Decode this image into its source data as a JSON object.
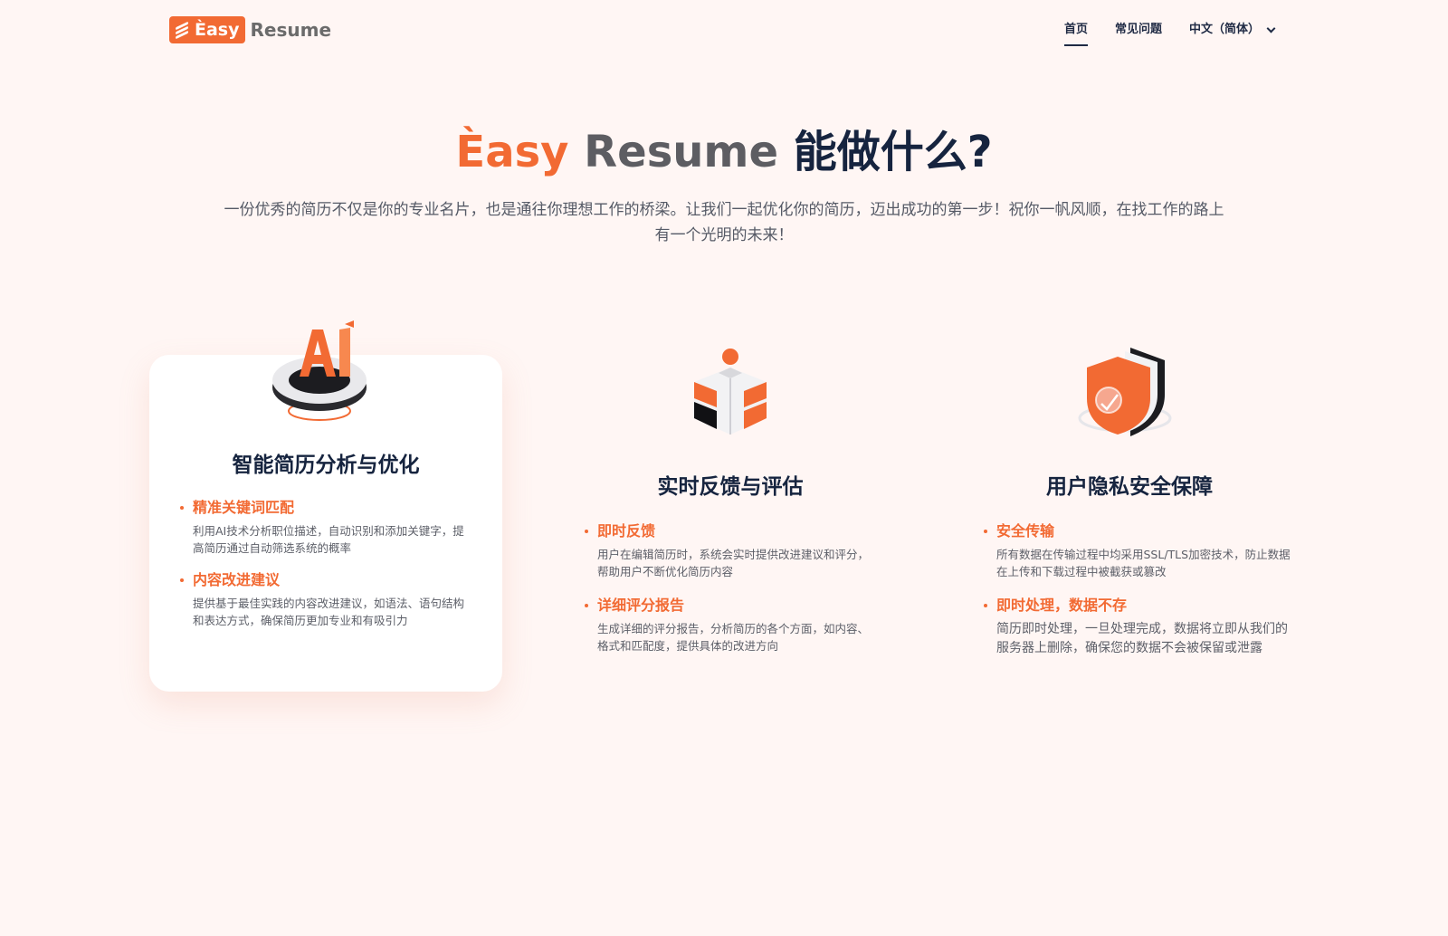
{
  "header": {
    "logo_badge": "Èasy",
    "logo_rest": "Resume",
    "nav": {
      "home": "首页",
      "faq": "常见问题",
      "language": "中文（简体）"
    }
  },
  "hero": {
    "title_easy": "Èasy",
    "title_resume": "Resume",
    "title_rest": "能做什么?",
    "subtitle": "一份优秀的简历不仅是你的专业名片，也是通往你理想工作的桥梁。让我们一起优化你的简历，迈出成功的第一步！祝你一帆风顺，在找工作的路上有一个光明的未来！"
  },
  "cards": [
    {
      "icon": "ai-icon",
      "title": "智能简历分析与优化",
      "features": [
        {
          "title": "精准关键词匹配",
          "desc": "利用AI技术分析职位描述，自动识别和添加关键字，提高简历通过自动筛选系统的概率"
        },
        {
          "title": "内容改进建议",
          "desc": "提供基于最佳实践的内容改进建议，如语法、语句结构和表达方式，确保简历更加专业和有吸引力"
        }
      ]
    },
    {
      "icon": "cube-blocks-icon",
      "title": "实时反馈与评估",
      "features": [
        {
          "title": "即时反馈",
          "desc": "用户在编辑简历时，系统会实时提供改进建议和评分，帮助用户不断优化简历内容"
        },
        {
          "title": "详细评分报告",
          "desc": "生成详细的评分报告，分析简历的各个方面，如内容、格式和匹配度，提供具体的改进方向"
        }
      ]
    },
    {
      "icon": "shield-icon",
      "title": "用户隐私安全保障",
      "features": [
        {
          "title": "安全传输",
          "desc": "所有数据在传输过程中均采用SSL/TLS加密技术，防止数据在上传和下载过程中被截获或篡改"
        },
        {
          "title": "即时处理，数据不存",
          "desc": "简历即时处理，一旦处理完成，数据将立即从我们的服务器上删除，确保您的数据不会被保留或泄露"
        }
      ]
    }
  ],
  "colors": {
    "accent": "#f26a33",
    "dark": "#16243f",
    "background": "#fff6f4"
  }
}
